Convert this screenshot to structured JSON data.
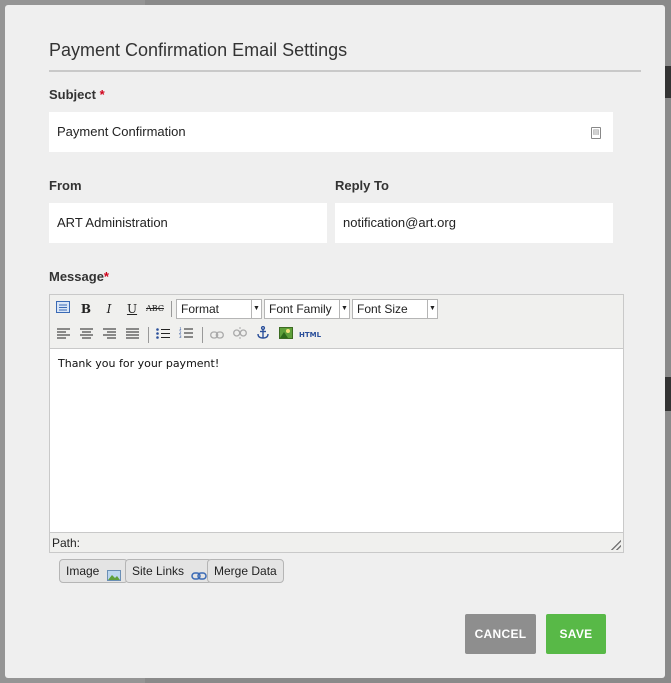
{
  "dialog": {
    "title": "Payment Confirmation Email Settings"
  },
  "subject": {
    "label": "Subject",
    "required_mark": "*",
    "value": "Payment Confirmation"
  },
  "from": {
    "label": "From",
    "value": "ART Administration"
  },
  "reply_to": {
    "label": "Reply To",
    "value": "notification@art.org"
  },
  "message": {
    "label": "Message",
    "required_mark": "*",
    "body": "Thank you for your payment!",
    "path_label": "Path:",
    "toolbar": {
      "bold": "B",
      "italic": "I",
      "underline": "U",
      "strike": "ABC",
      "format": "Format",
      "font_family": "Font Family",
      "font_size": "Font Size",
      "html": "HTML"
    }
  },
  "insert_buttons": {
    "image": "Image",
    "site_links": "Site Links",
    "merge_data": "Merge Data"
  },
  "actions": {
    "cancel": "CANCEL",
    "save": "SAVE"
  },
  "colors": {
    "save": "#58b947",
    "cancel": "#8e8e8e",
    "required": "#d0021b"
  }
}
